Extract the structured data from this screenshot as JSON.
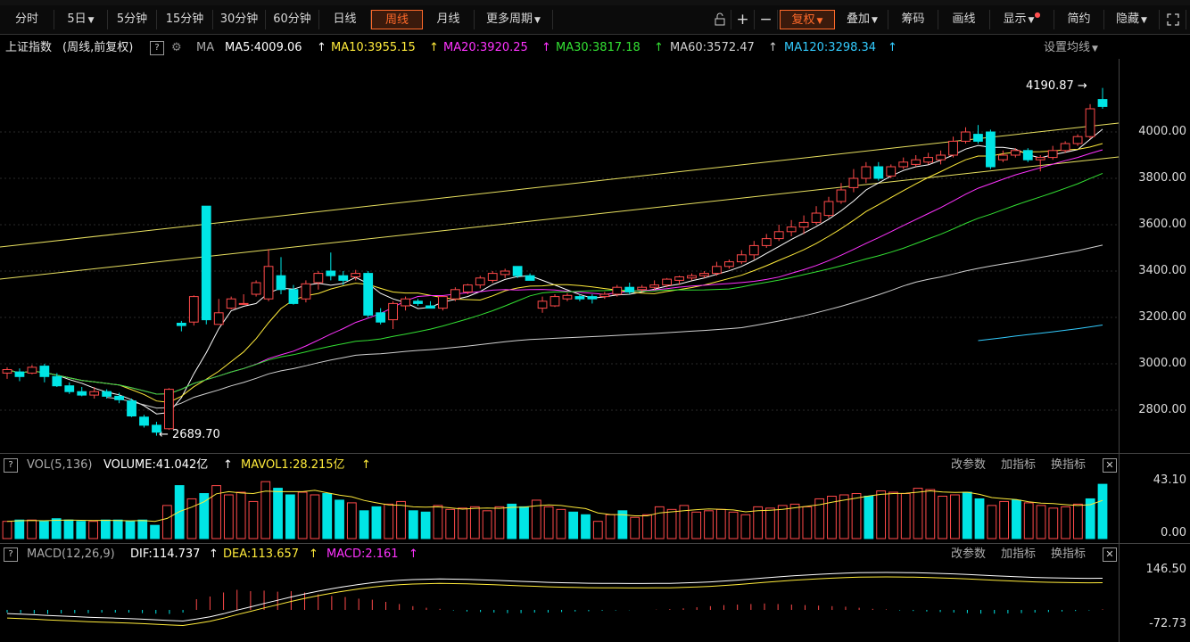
{
  "toolbar": {
    "periods": [
      "分时",
      "5日",
      "5分钟",
      "15分钟",
      "30分钟",
      "60分钟",
      "日线",
      "周线",
      "月线",
      "更多周期"
    ],
    "active_period": "周线",
    "right_tools": {
      "plus": "+",
      "minus": "−",
      "fuquan": "复权",
      "diejia": "叠加",
      "chouma": "筹码",
      "huaxian": "画线",
      "xianshi": "显示",
      "jianyue": "简约",
      "yincang": "隐藏"
    }
  },
  "legend": {
    "title": "上证指数",
    "subtitle": "(周线,前复权)",
    "ma_label": "MA",
    "ma5": "MA5:4009.06",
    "ma10": "MA10:3955.15",
    "ma20": "MA20:3920.25",
    "ma30": "MA30:3817.18",
    "ma60": "MA60:3572.47",
    "ma120": "MA120:3298.34",
    "settings": "设置均线"
  },
  "price_axis": [
    "4000.00",
    "3800.00",
    "3600.00",
    "3400.00",
    "3200.00",
    "3000.00",
    "2800.00"
  ],
  "annotations": {
    "high": "4190.87",
    "low": "2689.70"
  },
  "vol": {
    "label": "VOL(5,136)",
    "volume": "VOLUME:41.042亿",
    "mavol": "MAVOL1:28.215亿",
    "axis_top": "43.10",
    "axis_bottom": "0.00"
  },
  "macd": {
    "label": "MACD(12,26,9)",
    "dif": "DIF:114.737",
    "dea": "DEA:113.657",
    "macd": "MACD:2.161",
    "axis_top": "146.50",
    "axis_bottom": "-72.73"
  },
  "panel_links": {
    "params": "改参数",
    "add": "加指标",
    "switch": "换指标"
  },
  "colors": {
    "up": "#ff4a4a",
    "down": "#00e5e5",
    "ma5": "#ffffff",
    "ma10": "#ffeb3b",
    "ma20": "#ff33ff",
    "ma30": "#33e033",
    "ma60": "#d0d0d0",
    "ma120": "#33ccff",
    "accent": "#ff6a2a"
  },
  "candles": [
    [
      2960,
      2975,
      2935,
      2985,
      2
    ],
    [
      2965,
      2945,
      2925,
      2980,
      2
    ],
    [
      2960,
      2985,
      2955,
      2995,
      2
    ],
    [
      2990,
      2945,
      2920,
      3000,
      3
    ],
    [
      2945,
      2905,
      2900,
      2960,
      2
    ],
    [
      2905,
      2880,
      2870,
      2920,
      2
    ],
    [
      2880,
      2865,
      2860,
      2900,
      2
    ],
    [
      2865,
      2880,
      2850,
      2900,
      2
    ],
    [
      2880,
      2860,
      2850,
      2890,
      2
    ],
    [
      2860,
      2845,
      2830,
      2875,
      2
    ],
    [
      2840,
      2775,
      2770,
      2850,
      2
    ],
    [
      2770,
      2735,
      2725,
      2780,
      4
    ],
    [
      2735,
      2705,
      2690,
      2750,
      2
    ],
    [
      2720,
      2890,
      2715,
      2895,
      4
    ],
    [
      3175,
      3165,
      3140,
      3185,
      2
    ],
    [
      3180,
      3290,
      3165,
      3295,
      2
    ],
    [
      3680,
      3190,
      3170,
      3680,
      4
    ],
    [
      3170,
      3220,
      3170,
      3280,
      4
    ],
    [
      3240,
      3280,
      3235,
      3290,
      4
    ],
    [
      3260,
      3260,
      3255,
      3300,
      2
    ],
    [
      3300,
      3350,
      3290,
      3360,
      2
    ],
    [
      3280,
      3420,
      3270,
      3495,
      4
    ],
    [
      3380,
      3320,
      3300,
      3460,
      4
    ],
    [
      3320,
      3260,
      3255,
      3340,
      4
    ],
    [
      3280,
      3345,
      3265,
      3360,
      4
    ],
    [
      3350,
      3390,
      3320,
      3400,
      2
    ],
    [
      3400,
      3380,
      3360,
      3480,
      2
    ],
    [
      3380,
      3360,
      3340,
      3400,
      2
    ],
    [
      3375,
      3390,
      3360,
      3405,
      2
    ],
    [
      3390,
      3210,
      3200,
      3400,
      3
    ],
    [
      3220,
      3180,
      3170,
      3240,
      3
    ],
    [
      3190,
      3260,
      3150,
      3270,
      2
    ],
    [
      3250,
      3280,
      3230,
      3290,
      2
    ],
    [
      3270,
      3260,
      3250,
      3280,
      2
    ],
    [
      3250,
      3240,
      3240,
      3270,
      2
    ],
    [
      3240,
      3290,
      3230,
      3290,
      2
    ],
    [
      3280,
      3320,
      3270,
      3330,
      2
    ],
    [
      3310,
      3340,
      3300,
      3345,
      2
    ],
    [
      3340,
      3370,
      3325,
      3380,
      2
    ],
    [
      3360,
      3390,
      3350,
      3400,
      2
    ],
    [
      3385,
      3400,
      3370,
      3410,
      2
    ],
    [
      3420,
      3380,
      3370,
      3420,
      2
    ],
    [
      3380,
      3360,
      3360,
      3390,
      2
    ],
    [
      3240,
      3270,
      3220,
      3290,
      2
    ],
    [
      3250,
      3290,
      3245,
      3300,
      2
    ],
    [
      3280,
      3295,
      3270,
      3305,
      2
    ],
    [
      3290,
      3280,
      3270,
      3300,
      2
    ],
    [
      3290,
      3280,
      3260,
      3300,
      2
    ],
    [
      3290,
      3300,
      3280,
      3310,
      2
    ],
    [
      3300,
      3330,
      3290,
      3340,
      2
    ],
    [
      3330,
      3310,
      3300,
      3350,
      2
    ],
    [
      3320,
      3330,
      3310,
      3340,
      2
    ],
    [
      3330,
      3340,
      3320,
      3360,
      2
    ],
    [
      3340,
      3365,
      3330,
      3370,
      2
    ],
    [
      3360,
      3375,
      3340,
      3380,
      2
    ],
    [
      3370,
      3380,
      3360,
      3390,
      2
    ],
    [
      3380,
      3390,
      3370,
      3400,
      2
    ],
    [
      3390,
      3420,
      3380,
      3440,
      2
    ],
    [
      3420,
      3440,
      3410,
      3450,
      2
    ],
    [
      3440,
      3470,
      3430,
      3490,
      2
    ],
    [
      3470,
      3510,
      3450,
      3530,
      2
    ],
    [
      3510,
      3540,
      3500,
      3560,
      2
    ],
    [
      3540,
      3570,
      3530,
      3600,
      2
    ],
    [
      3570,
      3590,
      3550,
      3620,
      2
    ],
    [
      3590,
      3610,
      3560,
      3640,
      2
    ],
    [
      3610,
      3650,
      3600,
      3680,
      2
    ],
    [
      3640,
      3700,
      3630,
      3720,
      2
    ],
    [
      3700,
      3750,
      3690,
      3780,
      2
    ],
    [
      3760,
      3800,
      3740,
      3840,
      2
    ],
    [
      3800,
      3850,
      3780,
      3870,
      2
    ],
    [
      3850,
      3800,
      3790,
      3870,
      2
    ],
    [
      3810,
      3850,
      3800,
      3860,
      2
    ],
    [
      3850,
      3870,
      3840,
      3890,
      2
    ],
    [
      3860,
      3880,
      3850,
      3900,
      2
    ],
    [
      3870,
      3890,
      3860,
      3910,
      2
    ],
    [
      3880,
      3900,
      3860,
      3920,
      2
    ],
    [
      3900,
      3960,
      3890,
      3980,
      2
    ],
    [
      3960,
      4000,
      3950,
      4020,
      2
    ],
    [
      3990,
      3960,
      3950,
      4030,
      2
    ],
    [
      4000,
      3850,
      3840,
      4010,
      3
    ],
    [
      3880,
      3900,
      3870,
      3920,
      2
    ],
    [
      3900,
      3920,
      3890,
      3930,
      2
    ],
    [
      3920,
      3880,
      3870,
      3930,
      2
    ],
    [
      3880,
      3890,
      3830,
      3900,
      2
    ],
    [
      3890,
      3920,
      3880,
      3940,
      2
    ],
    [
      3920,
      3950,
      3910,
      3960,
      2
    ],
    [
      3950,
      3980,
      3940,
      3990,
      2
    ],
    [
      3980,
      4100,
      3970,
      4120,
      2
    ],
    [
      4140,
      4110,
      4100,
      4190,
      3
    ]
  ],
  "volumes": [
    13,
    14,
    14,
    13,
    15,
    14,
    13,
    13,
    14,
    14,
    13,
    14,
    10,
    25,
    40,
    30,
    34,
    40,
    33,
    35,
    28,
    43,
    38,
    33,
    35,
    33,
    34,
    29,
    27,
    21,
    24,
    26,
    28,
    21,
    20,
    25,
    22,
    23,
    24,
    21,
    24,
    26,
    24,
    29,
    24,
    22,
    20,
    18,
    13,
    18,
    21,
    16,
    18,
    24,
    22,
    25,
    20,
    21,
    22,
    20,
    18,
    24,
    23,
    25,
    26,
    24,
    30,
    32,
    33,
    34,
    32,
    36,
    35,
    34,
    38,
    37,
    32,
    33,
    35,
    30,
    25,
    28,
    29,
    27,
    25,
    23,
    24,
    26,
    30,
    41
  ],
  "macd_bars": [
    -10,
    -12,
    -14,
    -15,
    -13,
    -12,
    -12,
    -10,
    -10,
    -10,
    -12,
    -14,
    -15,
    -10,
    40,
    50,
    65,
    75,
    70,
    72,
    68,
    70,
    65,
    58,
    52,
    48,
    42,
    38,
    30,
    22,
    14,
    8,
    4,
    -2,
    -6,
    -8,
    -10,
    -12,
    -12,
    -10,
    -10,
    -8,
    -6,
    -5,
    -3,
    -2,
    -1,
    0,
    1,
    3,
    6,
    10,
    14,
    18,
    20,
    22,
    24,
    22,
    20,
    18,
    16,
    14,
    12,
    8,
    4,
    2,
    -2,
    -4,
    -6,
    -8,
    -10,
    -12,
    -14,
    -14,
    -13,
    -12,
    -10,
    -8,
    -6,
    -4,
    -2,
    2
  ]
}
